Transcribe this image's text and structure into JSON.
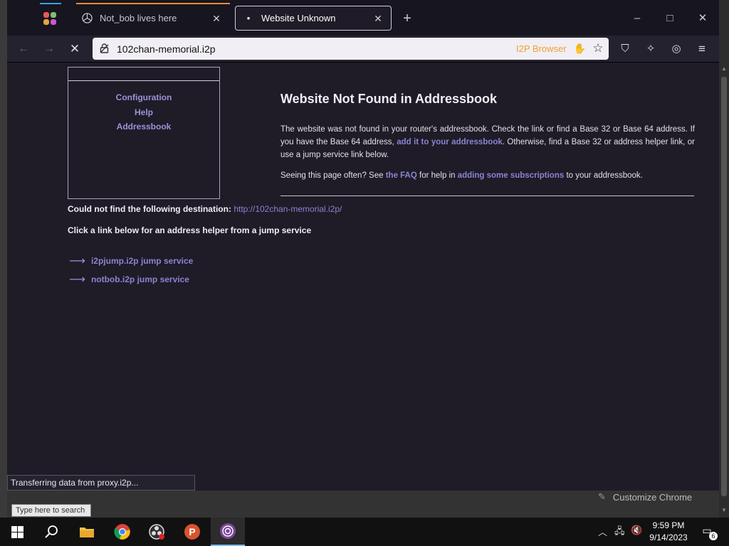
{
  "tabs": {
    "inactive": {
      "title": "Not_bob lives here"
    },
    "active": {
      "title": "Website Unknown"
    },
    "new_tab": "+"
  },
  "window_controls": {
    "minimize": "–",
    "maximize": "□",
    "close": "✕"
  },
  "navbar": {
    "url": "102chan-memorial.i2p",
    "brand": "I2P Browser"
  },
  "sidebar": {
    "links": [
      "Configuration",
      "Help",
      "Addressbook"
    ]
  },
  "main": {
    "title": "Website Not Found in Addressbook",
    "para1_a": "The website was not found in your router's addressbook. Check the link or find a Base 32 or Base 64 address. If you have the Base 64 address,",
    "para1_link": "add it to your addressbook",
    "para1_b": ". Otherwise, find a Base 32 or address helper link, or use a jump service link below.",
    "para2_a": "Seeing this page often? See",
    "para2_link1": "the FAQ",
    "para2_b": "for help in",
    "para2_link2": "adding some subscriptions",
    "para2_c": "to your addressbook."
  },
  "destination": {
    "label": "Could not find the following destination:",
    "url": "http://102chan-memorial.i2p/"
  },
  "jump": {
    "intro": "Click a link below for an address helper from a jump service",
    "services": [
      "i2pjump.i2p jump service",
      "notbob.i2p jump service"
    ]
  },
  "status_bar": {
    "text": "Transferring data from proxy.i2p..."
  },
  "customize": {
    "label": "Customize Chrome"
  },
  "search_tip": {
    "text": "Type here to search"
  },
  "clock": {
    "time": "9:59 PM",
    "date": "9/14/2023"
  },
  "notifications": {
    "count": "6"
  },
  "colors": {
    "accent_link": "#8a84d0",
    "brand_orange": "#f0a030",
    "page_bg": "#1f1b27"
  }
}
